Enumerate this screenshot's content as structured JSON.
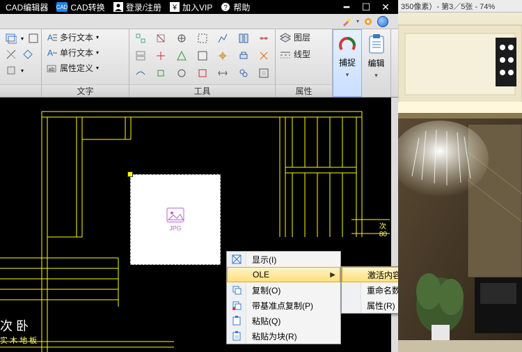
{
  "topbar": {
    "app_title": "CAD编辑器",
    "menus": [
      {
        "icon": "cad-badge",
        "label": "CAD转换"
      },
      {
        "icon": "user-icon",
        "label": "登录/注册"
      },
      {
        "icon": "yen-icon",
        "label": "加入VIP"
      },
      {
        "icon": "question-icon",
        "label": "帮助"
      }
    ]
  },
  "right_header": "350像素）- 第3／5张 - 74%",
  "ribbon": {
    "groups": {
      "text": {
        "rows": [
          "多行文本",
          "单行文本",
          "属性定义"
        ],
        "title": "文字"
      },
      "tool": {
        "title": "工具"
      },
      "attr": {
        "items": [
          "图层",
          "线型"
        ],
        "title": "属性"
      },
      "capture": "捕捉",
      "edit": "编辑"
    }
  },
  "canvas": {
    "room_label": "次 卧",
    "floor_label": "实 木 地 板",
    "dim_lookup": "次",
    "dim_value": "80"
  },
  "jpg": {
    "tag": "JPG"
  },
  "context_menu": {
    "items": [
      {
        "icon": "display-icon",
        "label": "显示(I)"
      },
      {
        "icon": "",
        "label": "OLE",
        "arrow": true,
        "hl": true
      },
      {
        "icon": "copy-icon",
        "label": "复制(O)"
      },
      {
        "icon": "copybase-icon",
        "label": "带基准点复制(P)"
      },
      {
        "icon": "paste-icon",
        "label": "粘贴(Q)"
      },
      {
        "icon": "pasteblock-icon",
        "label": "粘贴为块(R)"
      }
    ],
    "submenu": [
      {
        "label": "激活内容(Y)",
        "hl": true
      },
      {
        "label": "重命名数据包(Z)"
      },
      {
        "label": "属性(R)"
      }
    ]
  }
}
